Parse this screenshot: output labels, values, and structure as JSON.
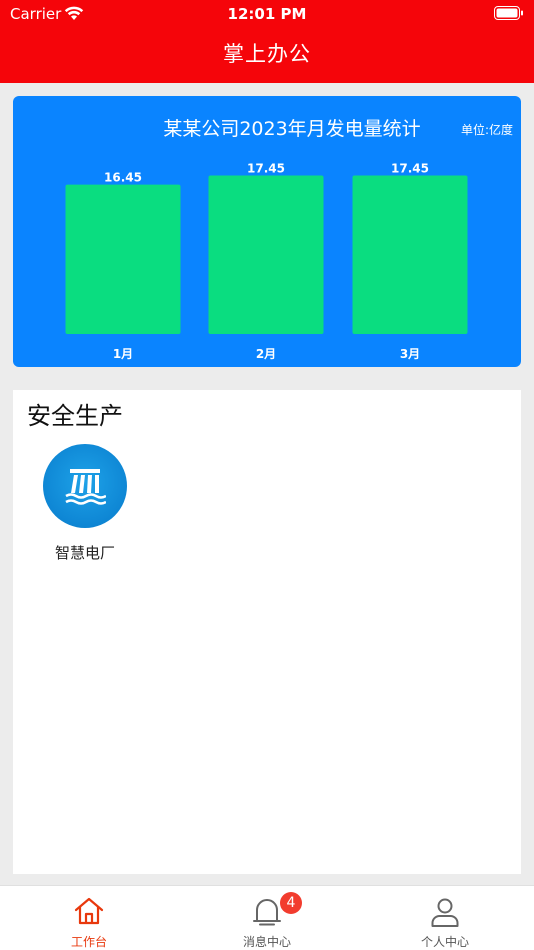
{
  "status_bar": {
    "carrier": "Carrier",
    "time": "12:01 PM"
  },
  "nav": {
    "title": "掌上办公"
  },
  "chart_card": {
    "unit_label": "单位:亿度",
    "chart_data": {
      "type": "bar",
      "title": "某某公司2023年月发电量统计",
      "categories": [
        "1月",
        "2月",
        "3月"
      ],
      "values": [
        16.45,
        17.45,
        17.45
      ],
      "value_labels": [
        "16.45",
        "17.45",
        "17.45"
      ],
      "ylim": [
        0,
        18.5
      ],
      "bar_color": "#0add80",
      "background_color": "#0a84ff",
      "grid": false
    }
  },
  "section": {
    "title": "安全生产",
    "apps": [
      {
        "label": "智慧电厂",
        "icon": "power-plant-icon"
      }
    ]
  },
  "tab_bar": {
    "tabs": [
      {
        "label": "工作台",
        "icon": "home-icon",
        "active": true
      },
      {
        "label": "消息中心",
        "icon": "bell-icon",
        "badge": "4"
      },
      {
        "label": "个人中心",
        "icon": "person-icon"
      }
    ]
  },
  "colors": {
    "brand_red": "#f5050a",
    "accent_orange": "#e8380d",
    "chart_blue": "#0a84ff"
  }
}
